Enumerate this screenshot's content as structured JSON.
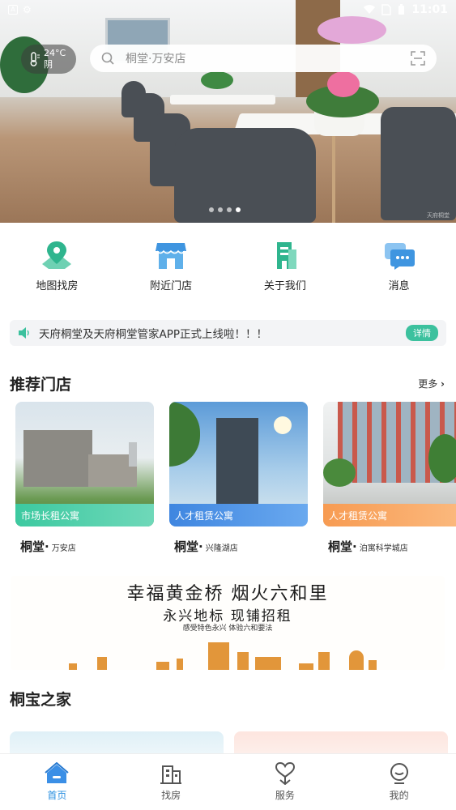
{
  "status_bar": {
    "time": "11:01",
    "notif_glyph": "A"
  },
  "weather": {
    "temp": "24°C",
    "condition": "阴"
  },
  "search": {
    "placeholder": "桐堂·万安店"
  },
  "banner_dots": {
    "count": 4,
    "active_index": 3
  },
  "quick_nav": [
    {
      "label": "地图找房",
      "icon": "map-pin-icon"
    },
    {
      "label": "附近门店",
      "icon": "store-icon"
    },
    {
      "label": "关于我们",
      "icon": "building-icon"
    },
    {
      "label": "消息",
      "icon": "chat-icon"
    }
  ],
  "notice": {
    "text": "天府桐堂及天府桐堂管家APP正式上线啦！！！",
    "detail_label": "详情"
  },
  "recommended": {
    "title": "推荐门店",
    "more_label": "更多"
  },
  "stores": [
    {
      "tag": "市场长租公寓",
      "brand": "桐堂·",
      "branch": "万安店",
      "tag_color": "#3cc9a0"
    },
    {
      "tag": "人才租赁公寓",
      "brand": "桐堂·",
      "branch": "兴隆湖店",
      "tag_color": "#4a8fe3"
    },
    {
      "tag": "人才租赁公寓",
      "brand": "桐堂·",
      "branch": "泊寓科学城店",
      "tag_color": "#f7a35c"
    }
  ],
  "promo": {
    "line1": "幸福黄金桥  烟火六和里",
    "line2": "永兴地标  现铺招租",
    "line3": "感受特色永兴  体验六和要法"
  },
  "home_section": {
    "title": "桐宝之家"
  },
  "tabbar": [
    {
      "label": "首页",
      "icon": "home-icon",
      "active": true
    },
    {
      "label": "找房",
      "icon": "buildings-icon",
      "active": false
    },
    {
      "label": "服务",
      "icon": "heart-hand-icon",
      "active": false
    },
    {
      "label": "我的",
      "icon": "profile-icon",
      "active": false
    }
  ],
  "colors": {
    "accent": "#2a8fe0",
    "green": "#3cc19e"
  }
}
